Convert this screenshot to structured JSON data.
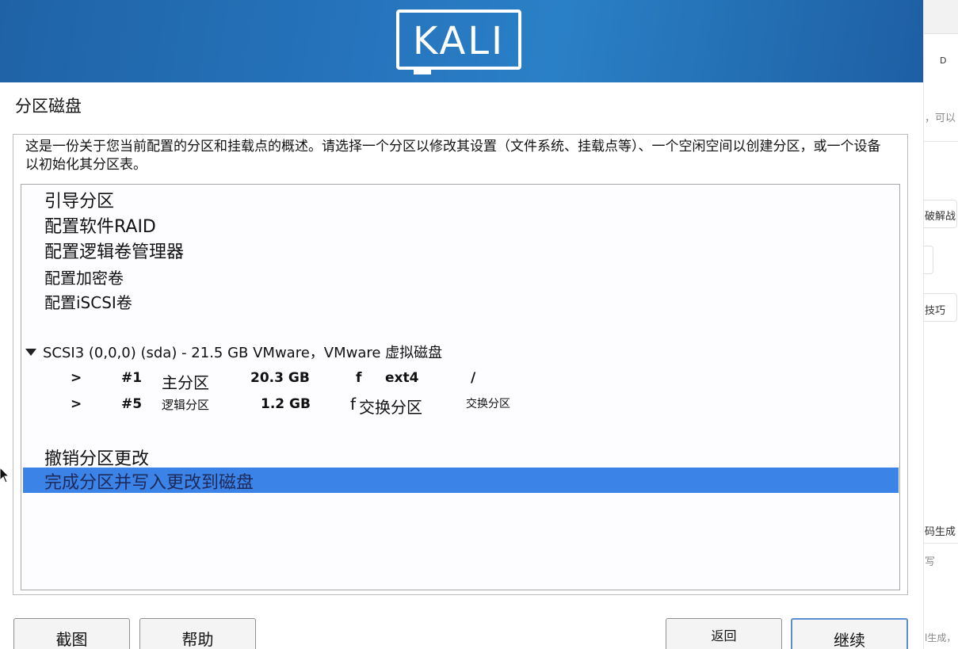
{
  "window": {
    "logo_text": "KALI",
    "title": "分区磁盘",
    "description": "这是一份关于您当前配置的分区和挂载点的概述。请选择一个分区以修改其设置（文件系统、挂载点等）、一个空闲空间以创建分区，或一个设备以初始化其分区表。"
  },
  "menu_items": [
    "引导分区",
    "配置软件RAID",
    "配置逻辑卷管理器",
    "配置加密卷",
    "配置iSCSI卷"
  ],
  "disk": {
    "label": "SCSI3 (0,0,0) (sda) - 21.5 GB VMware，VMware 虚拟磁盘"
  },
  "partitions": [
    {
      "arrow": ">",
      "number": "#1",
      "type": "主分区",
      "size": "20.3 GB",
      "flag": "f",
      "fs": "ext4",
      "mount": "/"
    },
    {
      "arrow": ">",
      "number": "#5",
      "type": "逻辑分区",
      "size": "1.2 GB",
      "flag": "f",
      "fs": "交换分区",
      "mount": "交换分区"
    }
  ],
  "actions": {
    "undo": "撤销分区更改",
    "finish": "完成分区并写入更改到磁盘"
  },
  "buttons": {
    "screenshot": "截图",
    "help": "帮助",
    "back": "返回",
    "continue": "继续"
  },
  "side_panel": {
    "t1": "D",
    "t2": "，可以",
    "t3": "破解战",
    "t4": "技巧",
    "t5": "码生成",
    "t6": "写",
    "t7": "l生成，"
  },
  "colors": {
    "banner": "#2674bd",
    "selection": "#3c83e8"
  }
}
